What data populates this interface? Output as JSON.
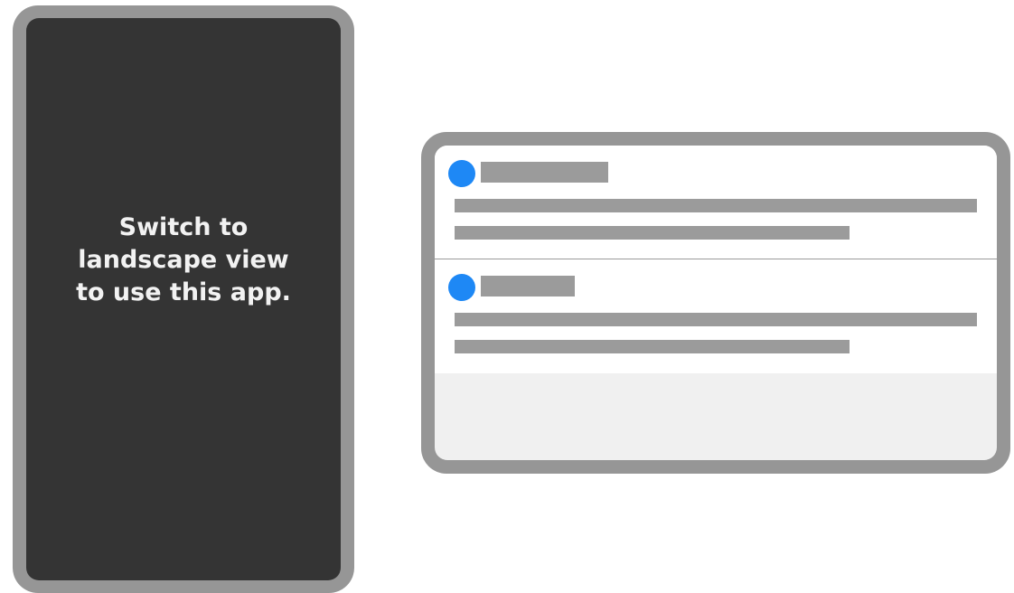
{
  "portrait_message": {
    "line1": "Switch to",
    "line2": "landscape view",
    "line3": "to use this app."
  },
  "colors": {
    "accent": "#1e88f5",
    "frame": "#969696",
    "portrait_screen": "#343434",
    "placeholder": "#9b9b9b"
  },
  "list_items": [
    {
      "avatar_icon": "avatar-circle-icon",
      "kind": "placeholder-row"
    },
    {
      "avatar_icon": "avatar-circle-icon",
      "kind": "placeholder-row"
    }
  ]
}
